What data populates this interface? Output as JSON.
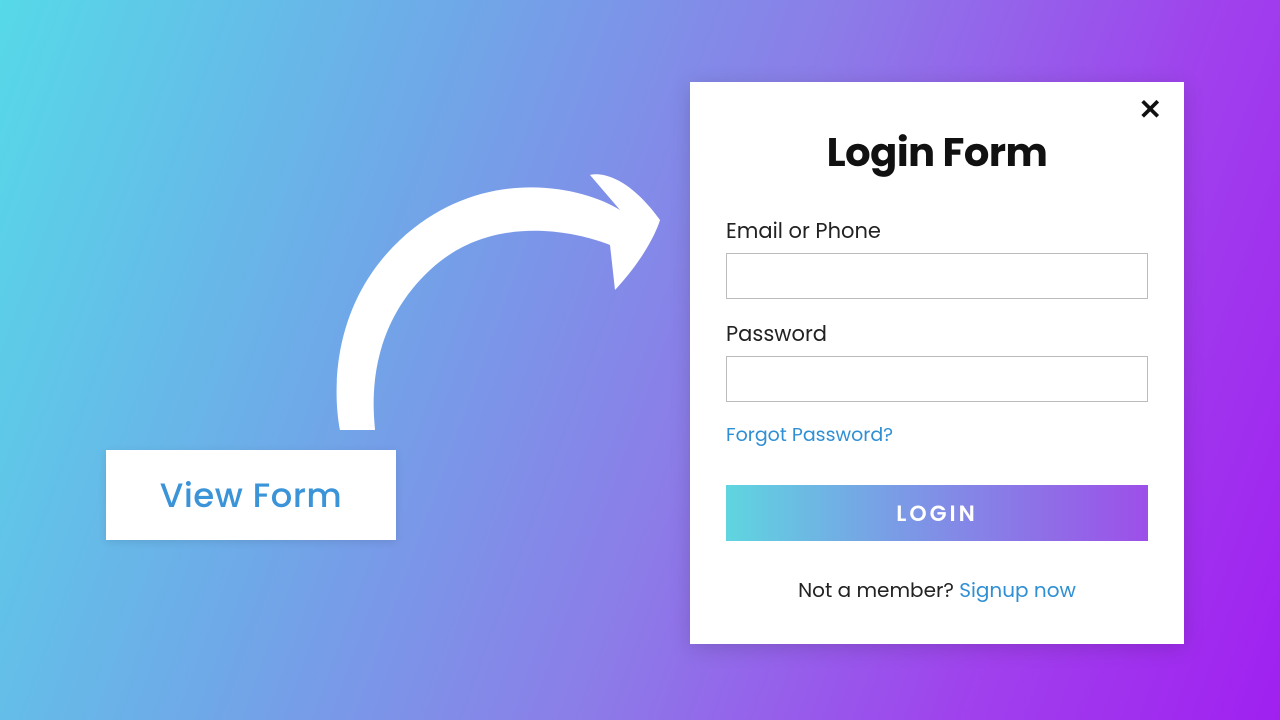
{
  "view_button": {
    "label": "View Form"
  },
  "login_card": {
    "title": "Login Form",
    "email_label": "Email or Phone",
    "password_label": "Password",
    "forgot_label": "Forgot Password?",
    "login_button_label": "LOGIN",
    "signup_prompt": "Not a member? ",
    "signup_link_label": "Signup now"
  },
  "icons": {
    "close": "✕"
  }
}
